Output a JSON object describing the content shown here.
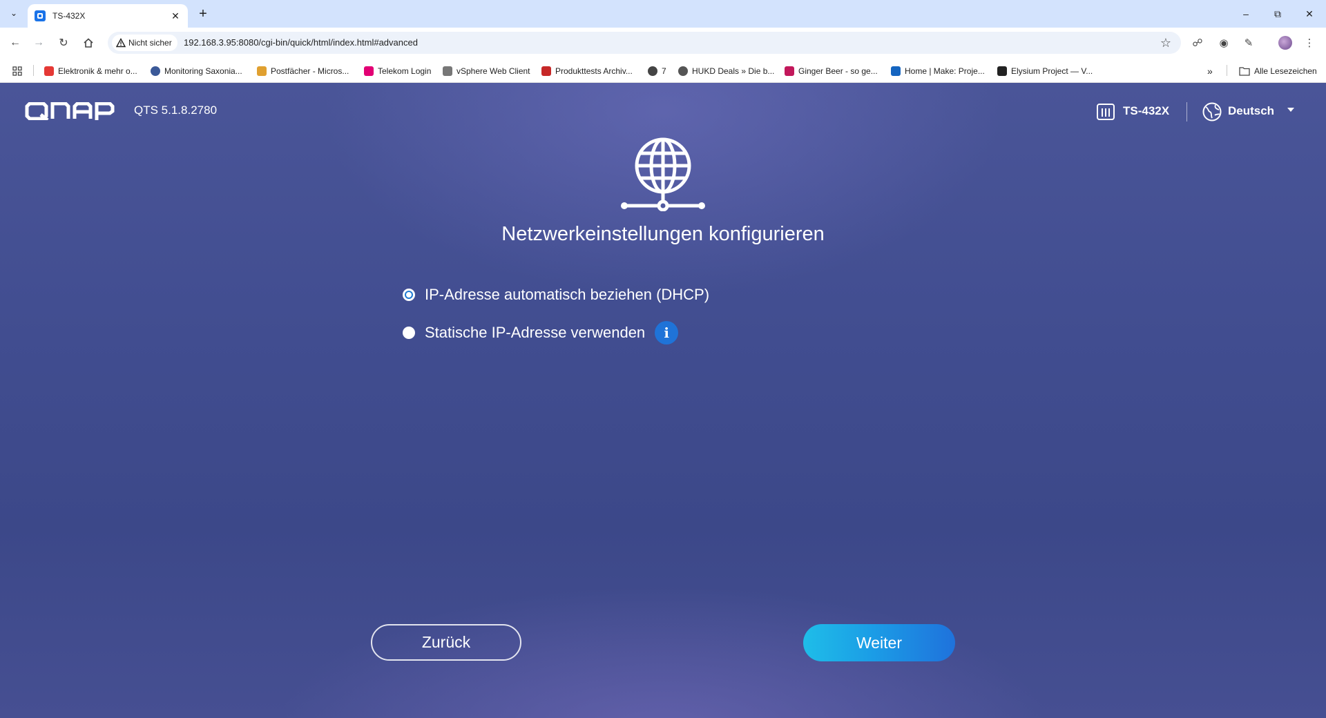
{
  "browser": {
    "tab": {
      "title": "TS-432X"
    },
    "omnibox": {
      "security_label": "Nicht sicher",
      "url": "192.168.3.95:8080/cgi-bin/quick/html/index.html#advanced"
    },
    "bookmarks": [
      {
        "label": "Elektronik & mehr o...",
        "icon": "amazon-a-icon",
        "color": "#e53935"
      },
      {
        "label": "Monitoring Saxonia...",
        "icon": "globe-icon",
        "color": "#3b5998"
      },
      {
        "label": "Postfächer - Micros...",
        "icon": "mail-icon",
        "color": "#e0a030"
      },
      {
        "label": "Telekom Login",
        "icon": "telekom-t-icon",
        "color": "#e20074"
      },
      {
        "label": "vSphere Web Client",
        "icon": "vsphere-icon",
        "color": "#555555"
      },
      {
        "label": "Produkttests Archiv...",
        "icon": "archive-icon",
        "color": "#c62828"
      },
      {
        "label": "7",
        "icon": "globe-icon",
        "color": "#444444"
      },
      {
        "label": "HUKD Deals » Die b...",
        "icon": "hukd-icon",
        "color": "#444444"
      },
      {
        "label": "Ginger Beer - so ge...",
        "icon": "ginger-icon",
        "color": "#c2185b"
      },
      {
        "label": "Home | Make: Proje...",
        "icon": "make-icon",
        "color": "#1565c0"
      },
      {
        "label": "Elysium Project — V...",
        "icon": "elysium-icon",
        "color": "#222222"
      }
    ],
    "all_bookmarks_label": "Alle Lesezeichen"
  },
  "header": {
    "brand": "QNAP",
    "version": "QTS 5.1.8.2780",
    "model": "TS-432X",
    "language": "Deutsch"
  },
  "main": {
    "title": "Netzwerkeinstellungen konfigurieren",
    "options": [
      {
        "label": "IP-Adresse automatisch beziehen (DHCP)",
        "selected": true
      },
      {
        "label": "Statische IP-Adresse verwenden",
        "selected": false
      }
    ],
    "info_glyph": "i"
  },
  "footer": {
    "back_label": "Zurück",
    "next_label": "Weiter"
  },
  "colors": {
    "accent": "#1e7ad3",
    "next_button_start": "#1fbde8",
    "next_button_end": "#1f72dc",
    "background": "#414d90"
  }
}
